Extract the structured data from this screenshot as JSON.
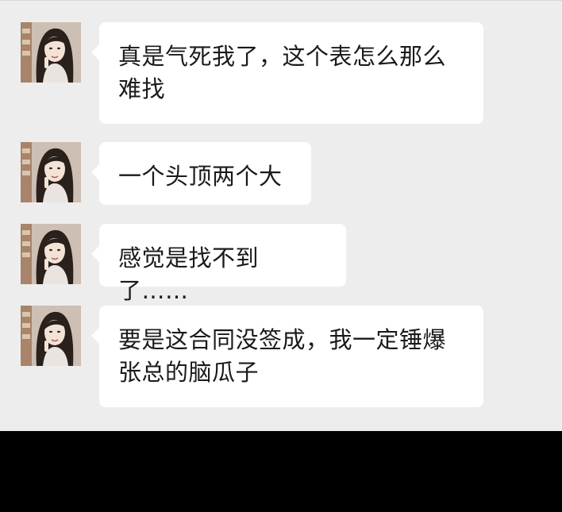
{
  "chat": {
    "messages": [
      {
        "text": "真是气死我了，这个表怎么那么难找",
        "sender_avatar": "avatar-woman-long-hair"
      },
      {
        "text": "一个头顶两个大",
        "sender_avatar": "avatar-woman-long-hair"
      },
      {
        "text": "感觉是找不到了……",
        "sender_avatar": "avatar-woman-long-hair"
      },
      {
        "text": "要是这合同没签成，我一定锤爆张总的脑瓜子",
        "sender_avatar": "avatar-woman-long-hair"
      }
    ]
  },
  "colors": {
    "chat_background": "#ededed",
    "bubble_background": "#ffffff",
    "text": "#1a1a1a",
    "bottom_bar": "#000000"
  }
}
